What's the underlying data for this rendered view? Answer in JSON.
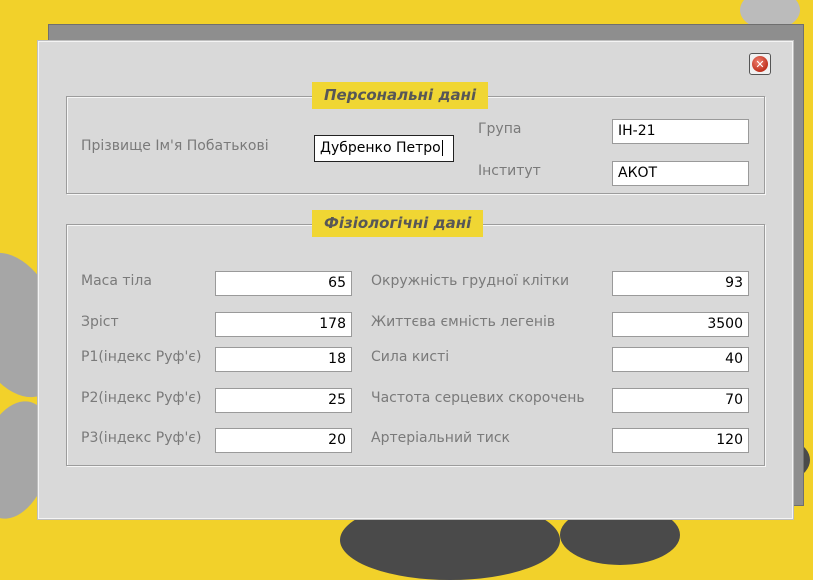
{
  "personal": {
    "legend": "Персональні дані",
    "name_label": "Прізвище Ім'я Побатькові",
    "name_value": "Дубренко Петро",
    "group_label": "Група",
    "group_value": "ІН-21",
    "institute_label": "Інститут",
    "institute_value": "АКОТ"
  },
  "physio": {
    "legend": "Фізіологічні дані",
    "left": [
      {
        "label": "Маса тіла",
        "value": "65"
      },
      {
        "label": "Зріст",
        "value": "178"
      },
      {
        "label": "Р1(індекс Руф'є)",
        "value": "18"
      },
      {
        "label": "Р2(індекс Руф'є)",
        "value": "25"
      },
      {
        "label": "Р3(індекс Руф'є)",
        "value": "20"
      }
    ],
    "right": [
      {
        "label": "Окружність грудної клітки",
        "value": "93"
      },
      {
        "label": "Життєва ємність легенів",
        "value": "3500"
      },
      {
        "label": "Сила кисті",
        "value": "40"
      },
      {
        "label": "Частота серцевих скорочень",
        "value": "70"
      },
      {
        "label": "Артеріальний тиск",
        "value": "120"
      }
    ]
  },
  "close_icon": "close-circle-icon",
  "colors": {
    "background": "#f2d12a",
    "legend_bg": "#f0d633",
    "dialog": "#d9d9d9"
  }
}
